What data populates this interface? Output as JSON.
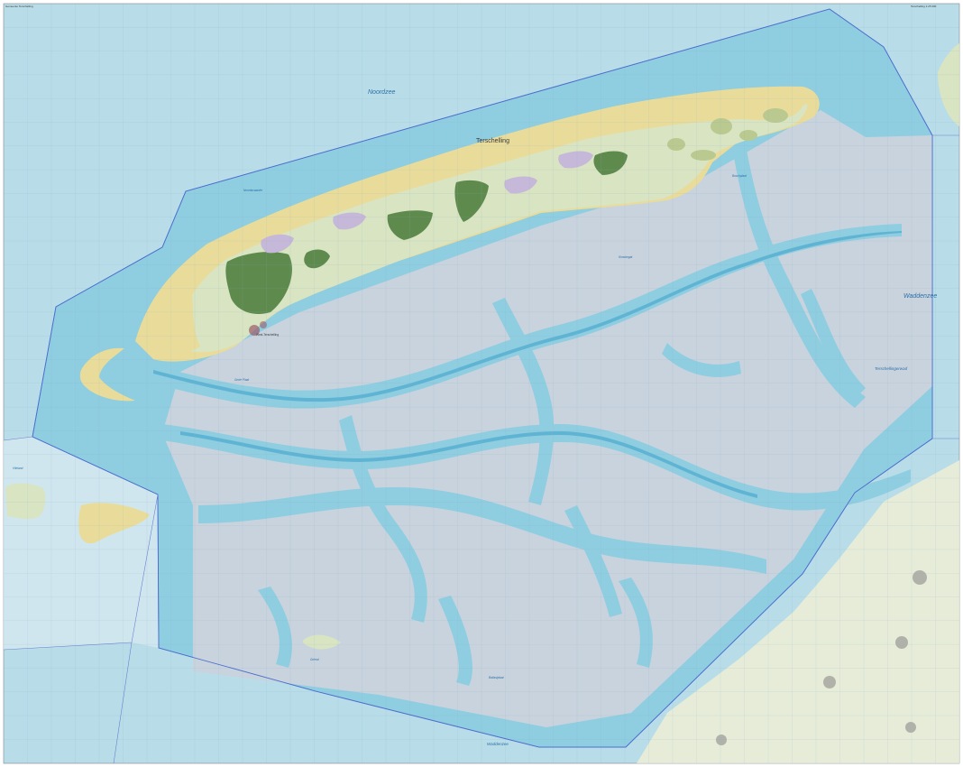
{
  "map": {
    "sheet_title": "Gemeente Terschelling",
    "sheet_code": "Terschelling 1:25 000",
    "colors": {
      "sea": "#b8dde8",
      "municipality_water": "#c8d3de",
      "tidal_channel": "#8fcde0",
      "deep_channel": "#5fb4d4",
      "dune_sand": "#e9dc9a",
      "polder": "#d9e4c2",
      "forest": "#5e8b4d",
      "heath": "#c6b8d8",
      "boundary": "#4d6fd0",
      "mainland": "#e6ecd8"
    },
    "labels": {
      "noordzee": "Noordzee",
      "terschelling": "Terschelling",
      "waddenzee": "Waddenzee",
      "waddenzee_bottom": "Waddenzee",
      "terschellingerwad": "Terschellingerwad",
      "boschplaat": "Boschplaat",
      "west_terschelling": "West-Terschelling",
      "griend": "Griend",
      "grote_plaat": "Grote Plaat",
      "ballastplaat": "Ballastplaat",
      "noordsvaarder": "Noordsvaarder",
      "kimstergat": "Kimstergat",
      "vlieland": "Vlieland"
    }
  }
}
